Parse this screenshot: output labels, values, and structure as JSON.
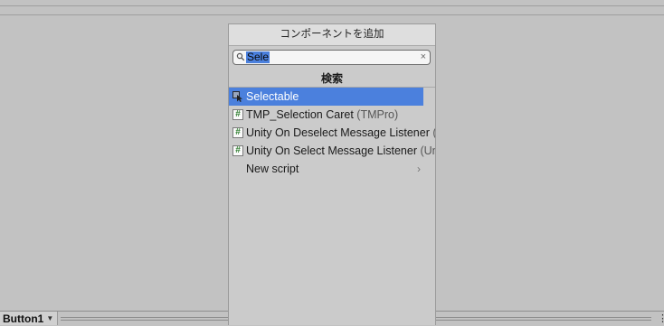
{
  "popup": {
    "title": "コンポーネントを追加",
    "search": {
      "value": "Sele",
      "clear_glyph": "×"
    },
    "section_title": "検索",
    "items": [
      {
        "label": "Selectable",
        "sublabel": "",
        "icon": "selectable-icon",
        "selected": true
      },
      {
        "label": "TMP_Selection Caret",
        "sublabel": " (TMPro)",
        "icon": "script-icon",
        "selected": false
      },
      {
        "label": "Unity On Deselect Message Listener",
        "sublabel": " (U",
        "icon": "script-icon",
        "selected": false
      },
      {
        "label": "Unity On Select Message Listener",
        "sublabel": " (Un",
        "icon": "script-icon",
        "selected": false
      },
      {
        "label": "New script",
        "sublabel": "",
        "icon": "",
        "selected": false
      }
    ],
    "hash_glyph": "#",
    "chevron_glyph": "›"
  },
  "bottom": {
    "object_name": "Button1",
    "caret_glyph": "▼",
    "more_glyph": "⋮"
  },
  "colors": {
    "selection": "#4b80dd",
    "background": "#c2c2c2"
  }
}
